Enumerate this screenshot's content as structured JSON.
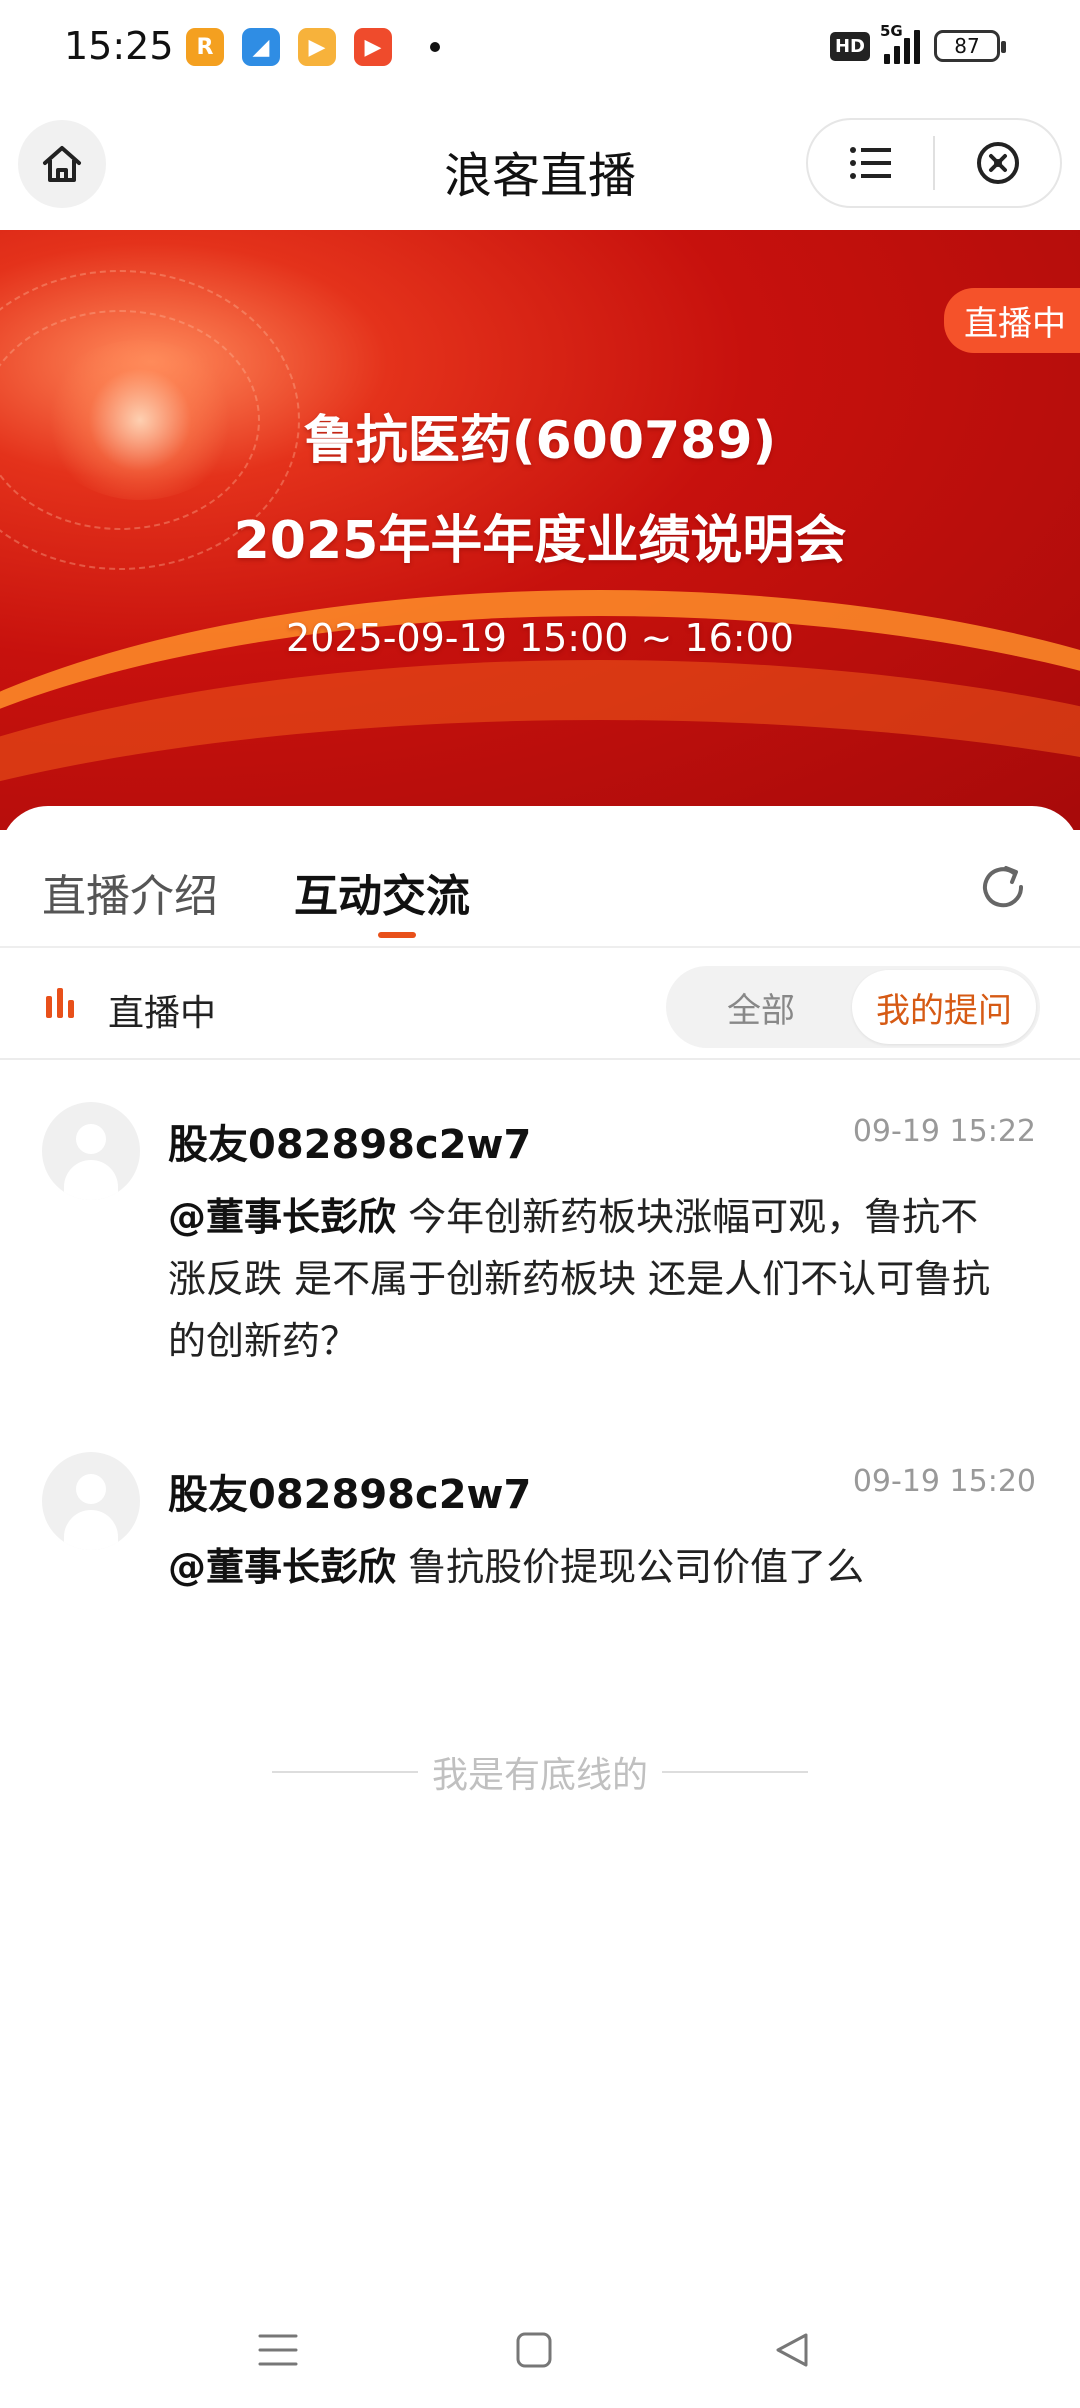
{
  "status_bar": {
    "time": "15:25",
    "apps": [
      {
        "icon": "r-app-icon",
        "color": "#f4a020",
        "glyph": "R"
      },
      {
        "icon": "feather-app-icon",
        "color": "#2f8de4",
        "glyph": "◢"
      },
      {
        "icon": "video-app-icon",
        "color": "#f7b23b",
        "glyph": "▶"
      },
      {
        "icon": "play-app-icon",
        "color": "#ef4b2c",
        "glyph": "▶"
      }
    ],
    "hd": "HD",
    "network": "5G",
    "battery": "87"
  },
  "title_bar": {
    "title": "浪客直播"
  },
  "banner": {
    "live_tag": "直播中",
    "title_line1": "鲁抗医药(600789)",
    "title_line2": "2025年半年度业绩说明会",
    "datetime": "2025-09-19 15:00 ~ 16:00"
  },
  "tabs": {
    "intro": "直播介绍",
    "chat": "互动交流",
    "active": "chat"
  },
  "filter": {
    "live_label": "直播中",
    "all": "全部",
    "mine": "我的提问",
    "selected": "mine",
    "accent": "#e8501a"
  },
  "messages": [
    {
      "user": "股友082898c2w7",
      "time": "09-19 15:22",
      "mention": "@董事长彭欣",
      "text": " 今年创新药板块涨幅可观，鲁抗不涨反跌 是不属于创新药板块 还是人们不认可鲁抗的创新药？"
    },
    {
      "user": "股友082898c2w7",
      "time": "09-19 15:20",
      "mention": "@董事长彭欣",
      "text": " 鲁抗股价提现公司价值了么"
    }
  ],
  "end_text": "我是有底线的"
}
